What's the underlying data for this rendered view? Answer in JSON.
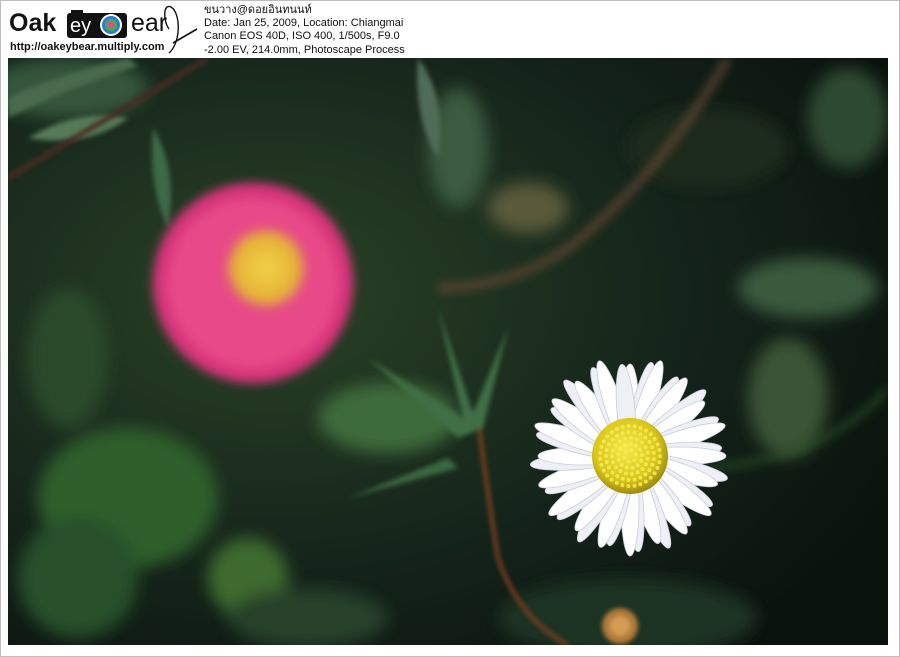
{
  "logo": {
    "wordmark_left": "Oak",
    "wordmark_mid": "ey",
    "wordmark_right": "ear",
    "url": "http://oakeybear.multiply.com"
  },
  "caption": {
    "line1": "ขนวาง@ดอยอินทนนท์",
    "line2": "Date: Jan 25, 2009, Location: Chiangmai",
    "line3": "Canon EOS 40D, ISO 400, 1/500s, F9.0",
    "line4": "-2.00 EV, 214.0mm, Photoscape Process"
  },
  "photo": {
    "subject": "white daisy with yellow center, blurred pink flower",
    "colors": {
      "background": "#0d1710",
      "foliage": "#2f5a2a",
      "pink_petals": "#e0407a",
      "pink_center": "#e8c23a",
      "daisy_petals": "#f6f6fa",
      "daisy_center": "#e5d21e",
      "stem": "#7a3e22"
    }
  }
}
